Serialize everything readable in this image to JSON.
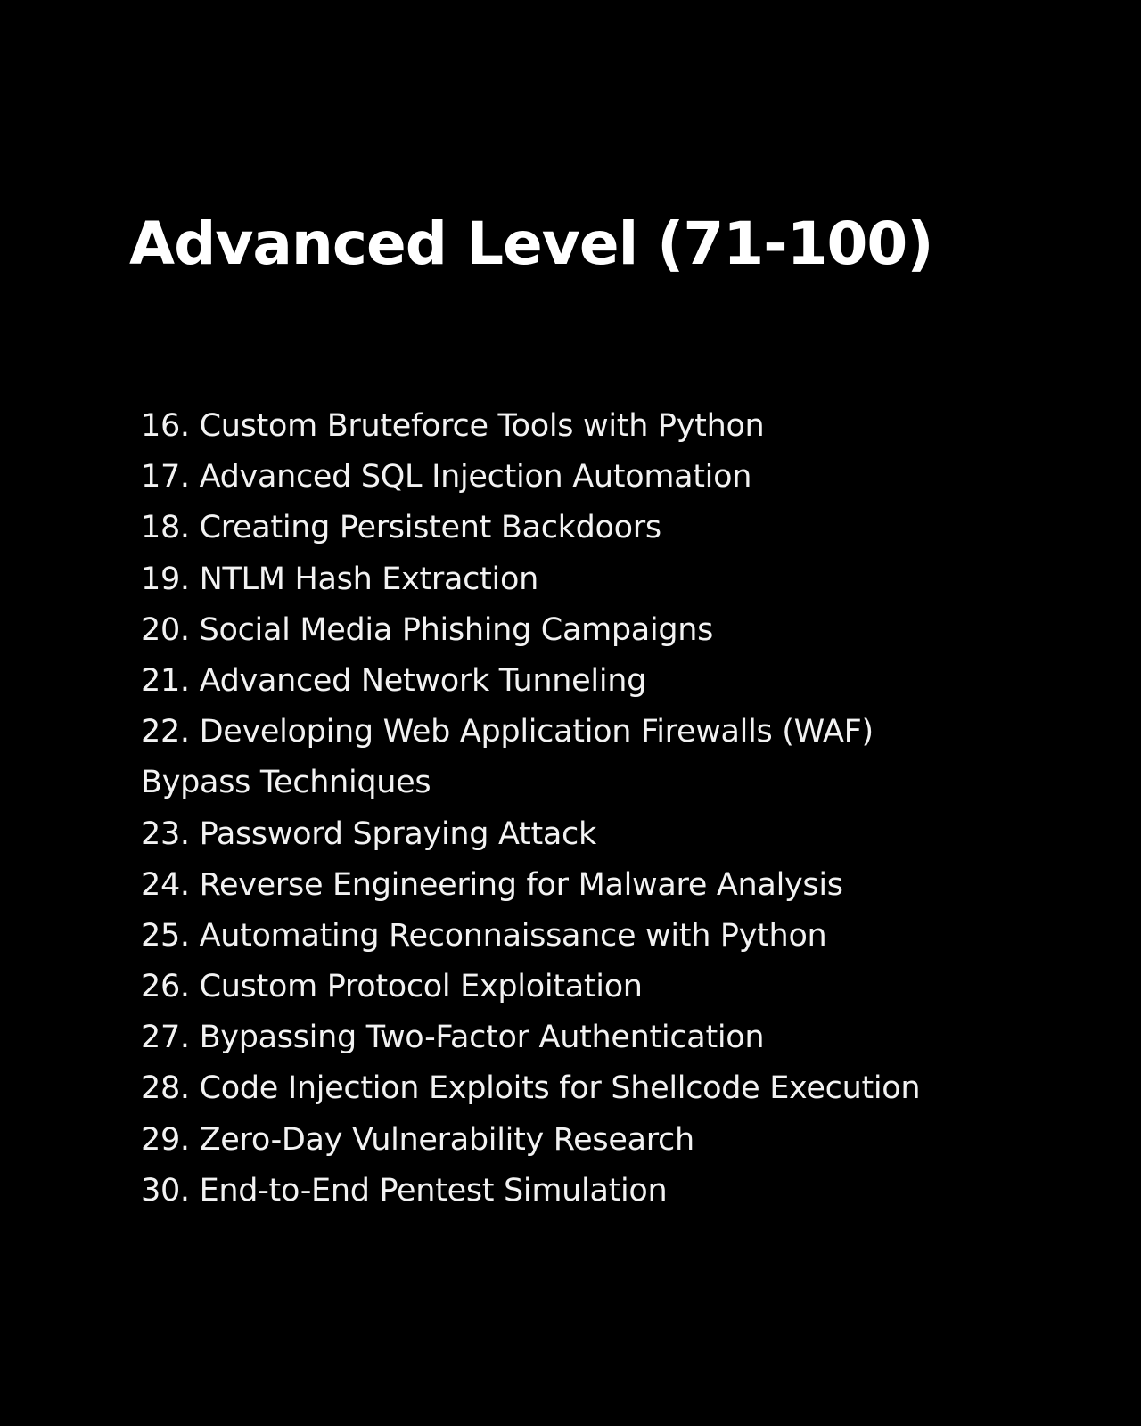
{
  "document": {
    "title": "Advanced Level (71-100)",
    "lines": [
      "16. Custom Bruteforce Tools with Python",
      "17. Advanced SQL Injection Automation",
      "18. Creating Persistent Backdoors",
      "19. NTLM Hash Extraction",
      "20. Social Media Phishing Campaigns",
      "21. Advanced Network Tunneling",
      "22. Developing Web Application Firewalls (WAF)",
      "Bypass Techniques",
      "23. Password Spraying Attack",
      "24. Reverse Engineering for Malware Analysis",
      "25. Automating Reconnaissance with Python",
      "26. Custom Protocol Exploitation",
      "27. Bypassing Two-Factor Authentication",
      "28. Code Injection Exploits for Shellcode Execution",
      "29. Zero-Day Vulnerability Research",
      "30. End-to-End Pentest Simulation"
    ]
  },
  "colors": {
    "background": "#000000",
    "text": "#ffffff"
  }
}
